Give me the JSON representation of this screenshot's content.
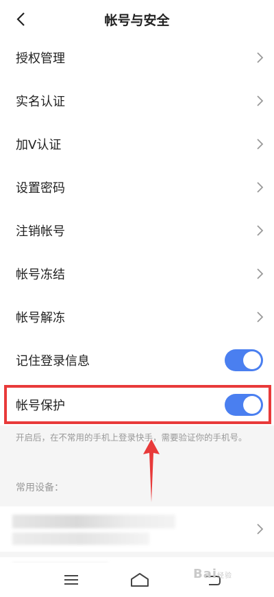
{
  "header": {
    "title": "帐号与安全"
  },
  "menu": [
    {
      "label": "授权管理"
    },
    {
      "label": "实名认证"
    },
    {
      "label": "加V认证"
    },
    {
      "label": "设置密码"
    },
    {
      "label": "注销帐号"
    },
    {
      "label": "帐号冻结"
    },
    {
      "label": "帐号解冻"
    }
  ],
  "toggles": [
    {
      "label": "记住登录信息",
      "on": true
    },
    {
      "label": "帐号保护",
      "on": true
    }
  ],
  "hint": "开启后，在不常用的手机上登录快手，需要验证你的手机号。",
  "devices": {
    "title": "常用设备："
  },
  "watermark": {
    "brand": "Bai",
    "sub": "经验"
  },
  "colors": {
    "toggle_on": "#4a7ff0",
    "annotation": "#e83a3a"
  },
  "icons": {
    "back": "chevron-left-icon",
    "chevron": "chevron-right-icon",
    "nav_menu": "menu-icon",
    "nav_home": "home-icon",
    "nav_back": "back-icon"
  }
}
